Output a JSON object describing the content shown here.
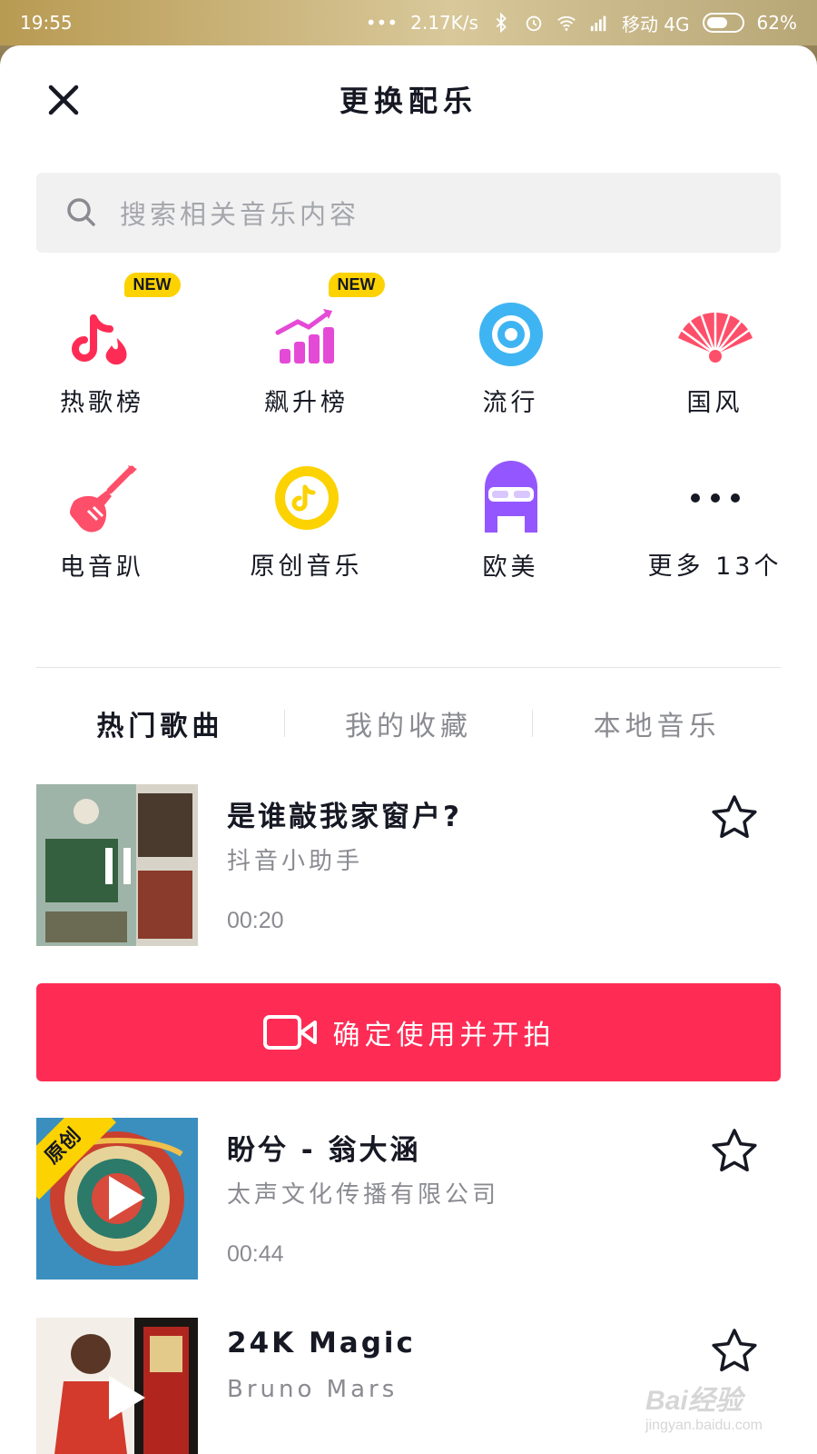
{
  "status_bar": {
    "time": "19:55",
    "speed": "2.17K/s",
    "carrier": "移动 4G",
    "battery_text": "62%",
    "battery_level": 0.62,
    "dots": "•••"
  },
  "header": {
    "title": "更换配乐"
  },
  "search": {
    "placeholder": "搜索相关音乐内容"
  },
  "categories": [
    {
      "label": "热歌榜",
      "icon": "tiktok-fire-icon",
      "badge": "NEW",
      "color": "#fe2c55"
    },
    {
      "label": "飙升榜",
      "icon": "rising-chart-icon",
      "badge": "NEW",
      "color": "#e54ad6"
    },
    {
      "label": "流行",
      "icon": "vinyl-disc-icon",
      "badge": "",
      "color": "#3fb4f2"
    },
    {
      "label": "国风",
      "icon": "folding-fan-icon",
      "badge": "",
      "color": "#fe4f6a"
    },
    {
      "label": "电音趴",
      "icon": "electric-guitar-icon",
      "badge": "",
      "color": "#fe4f6a"
    },
    {
      "label": "原创音乐",
      "icon": "original-music-icon",
      "badge": "",
      "color": "#fcd200"
    },
    {
      "label": "欧美",
      "icon": "sunglasses-face-icon",
      "badge": "",
      "color": "#9457ff"
    },
    {
      "label": "更多 13个",
      "icon": "more-dots-icon",
      "badge": "",
      "color": "#161823"
    }
  ],
  "tabs": [
    {
      "label": "热门歌曲",
      "active": true
    },
    {
      "label": "我的收藏",
      "active": false
    },
    {
      "label": "本地音乐",
      "active": false
    }
  ],
  "songs": [
    {
      "name": "是谁敲我家窗户?",
      "artist": "抖音小助手",
      "duration": "00:20",
      "tag": ""
    },
    {
      "name": "盼兮 - 翁大涵",
      "artist": "太声文化传播有限公司",
      "duration": "00:44",
      "tag": "原创"
    },
    {
      "name": "24K Magic",
      "artist": "Bruno Mars",
      "duration": "",
      "tag": ""
    }
  ],
  "confirm_button": {
    "label": "确定使用并开拍"
  },
  "watermark": {
    "text": "Bai经验",
    "sub": "jingyan.baidu.com"
  },
  "colors": {
    "accent": "#fe2c55",
    "badge": "#fcd200",
    "text_primary": "#161823",
    "text_secondary": "#8a8b91"
  }
}
